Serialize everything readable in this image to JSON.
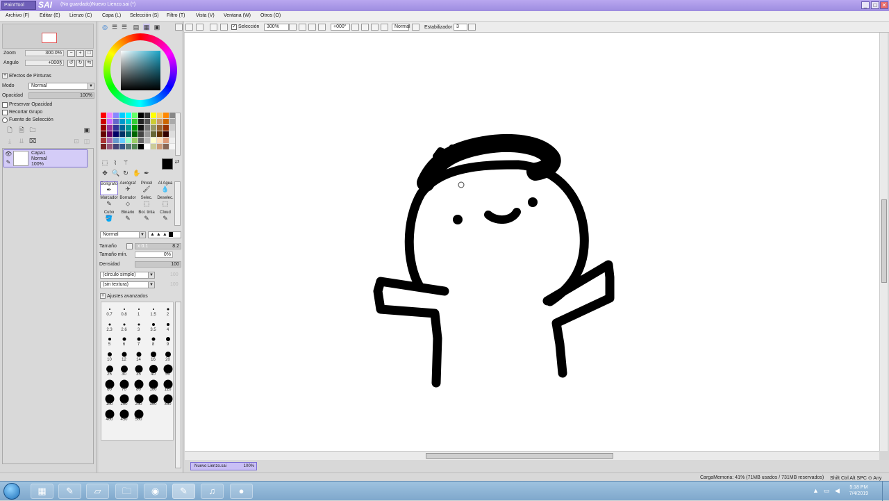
{
  "window": {
    "logo_small": "PaintTool",
    "logo_big": "SAI",
    "title": "(No guardado)Nuevo Lienzo.sai (*)"
  },
  "menu": [
    "Archivo (F)",
    "Editar (E)",
    "Lienzo (C)",
    "Capa (L)",
    "Selección (S)",
    "Filtro (T)",
    "Vista (V)",
    "Ventana (W)",
    "Otros (O)"
  ],
  "navigator": {
    "zoom_label": "Zoom",
    "zoom_value": "300.0%",
    "angle_label": "Angulo",
    "angle_value": "+000§"
  },
  "layer_panel": {
    "effects_label": "Efectos de Pinturas",
    "mode_label": "Modo",
    "mode_value": "Normal",
    "opacity_label": "Opacidad",
    "opacity_value": "100%",
    "checks": [
      "Preservar Opacidad",
      "Recortar Grupo",
      "Fuente de Selección"
    ],
    "layer": {
      "name": "Capa1",
      "mode": "Normal",
      "opacity": "100%"
    }
  },
  "tools": {
    "rows": [
      [
        "Bolígrafo",
        "Aerógraf",
        "Pincel",
        "Al Agua"
      ],
      [
        "Marcador",
        "Borrador",
        "Selec.",
        "Deselec."
      ],
      [
        "Cubo",
        "Binario",
        "Bol. tinta",
        "Cloud"
      ]
    ],
    "active": "Bolígrafo"
  },
  "brush": {
    "blend_mode": "Normal",
    "size_label": "Tamaño",
    "size_multiplier": "x 0.1",
    "size_value": "8.2",
    "min_size_label": "Tamaño mín.",
    "min_size_value": "0%",
    "density_label": "Densidad",
    "density_value": "100",
    "shape": "(círculo simple)",
    "texture": "(sin textura)",
    "shape_strength": "100",
    "texture_strength": "100",
    "advanced_label": "Ajustes avanzados"
  },
  "brush_sizes": [
    "0.7",
    "0.8",
    "1",
    "1.5",
    "2",
    "2.3",
    "2.6",
    "3",
    "3.5",
    "4",
    "5",
    "6",
    "7",
    "8",
    "9",
    "10",
    "12",
    "14",
    "16",
    "20",
    "25",
    "30",
    "35",
    "40",
    "50",
    "60",
    "70",
    "80",
    "100",
    "120",
    "160",
    "200",
    "250",
    "300",
    "350",
    "400",
    "450",
    "500"
  ],
  "toolbar": {
    "selection_label": "Selección",
    "zoom": "300%",
    "angle": "+000°",
    "mode": "Normal",
    "stabilizer_label": "Estabilizador",
    "stabilizer_value": "3"
  },
  "document_tab": {
    "name": "Nuevo Lienzo.sai",
    "zoom": "100%"
  },
  "status": {
    "memory": "CargaMemoria: 41% (71MB usados / 731MB reservados)",
    "keys": "Shift Ctrl Alt SPC ⊙ Any"
  },
  "taskbar": {
    "apps": [
      "taskbar-app-1",
      "sai-app",
      "app-3",
      "folder",
      "chrome",
      "sai-active",
      "itunes",
      "obs"
    ],
    "time": "5:18 PM",
    "date": "7/4/2019"
  },
  "colors": {
    "accent": "#8a7ad8",
    "title_bar": "#a996ea",
    "current_color": "#000000"
  }
}
